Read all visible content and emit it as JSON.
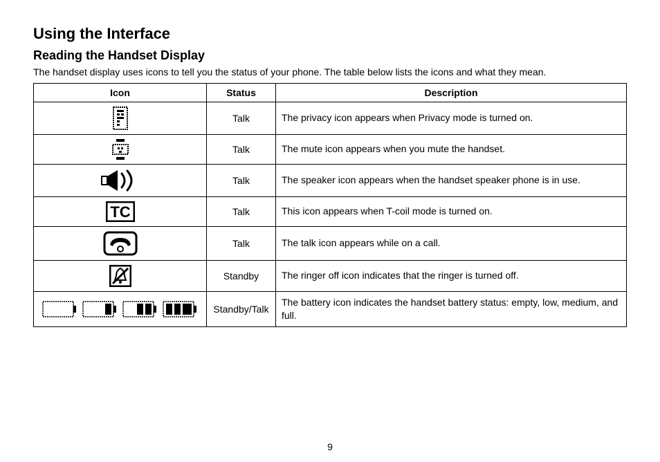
{
  "heading1": "Using the Interface",
  "heading2": "Reading the Handset Display",
  "intro": "The handset display uses icons to tell you the status of your phone. The table below lists the icons and what they mean.",
  "table": {
    "headers": {
      "icon": "Icon",
      "status": "Status",
      "description": "Description"
    },
    "rows": [
      {
        "icon_name": "privacy-icon",
        "status": "Talk",
        "description": "The privacy icon appears when Privacy mode is turned on."
      },
      {
        "icon_name": "mute-icon",
        "status": "Talk",
        "description": "The mute icon appears when you mute the handset."
      },
      {
        "icon_name": "speaker-icon",
        "status": "Talk",
        "description": "The speaker icon appears when the handset speaker phone is in use."
      },
      {
        "icon_name": "tcoil-icon",
        "status": "Talk",
        "description": "This icon appears when T-coil mode is turned on."
      },
      {
        "icon_name": "talk-icon",
        "status": "Talk",
        "description": "The talk icon appears while on a call."
      },
      {
        "icon_name": "ringer-off-icon",
        "status": "Standby",
        "description": "The ringer off icon indicates that the ringer is turned off."
      },
      {
        "icon_name": "battery-icon",
        "status": "Standby/Talk",
        "description": "The battery icon indicates the handset battery status: empty, low, medium, and full."
      }
    ]
  },
  "page_number": "9"
}
